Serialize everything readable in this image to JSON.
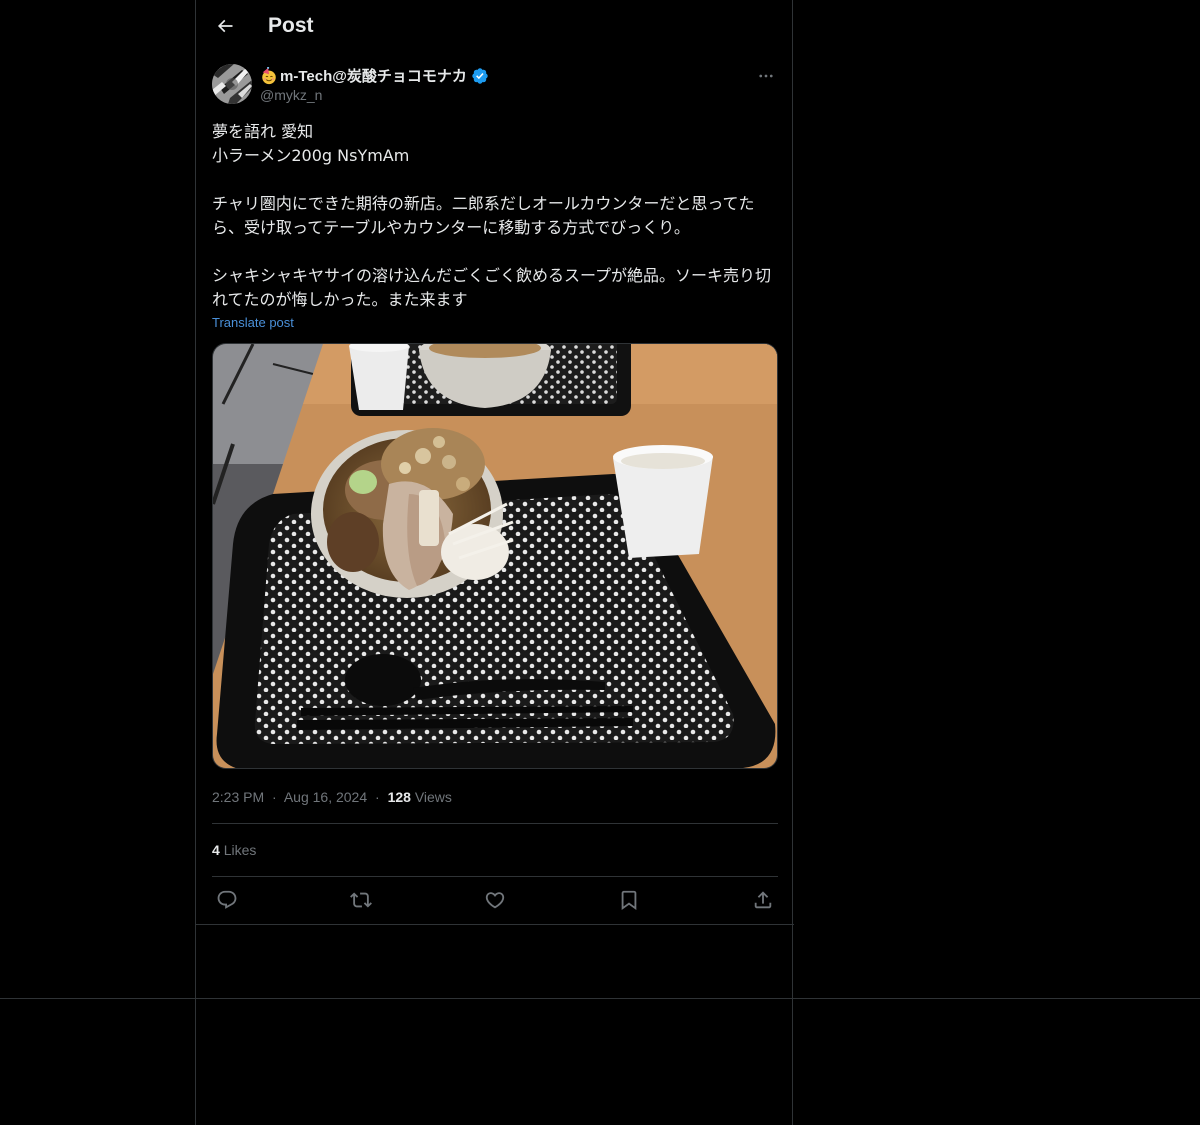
{
  "header": {
    "title": "Post"
  },
  "post": {
    "author": {
      "display_name": "m-Tech@炭酸チョコモナカ",
      "handle": "@mykz_n",
      "verified": true
    },
    "text": "夢を語れ 愛知\n小ラーメン200g NsYmAm\n\nチャリ圏内にできた期待の新店。二郎系だしオールカウンターだと思ってたら、受け取ってテーブルやカウンターに移動する方式でびっくり。\n\nシャキシャキヤサイの溶け込んだごくごく飲めるスープが絶品。ソーキ売り切れてたのが悔しかった。また来ます",
    "translate_label": "Translate post",
    "time": "2:23 PM",
    "date": "Aug 16, 2024",
    "separator": "·",
    "views_count": "128",
    "views_label": "Views",
    "likes_count": "4",
    "likes_label": "Likes"
  },
  "icons": {
    "back": "arrow-left-icon",
    "more": "more-horizontal-icon",
    "reply": "reply-icon",
    "repost": "repost-icon",
    "like": "heart-icon",
    "bookmark": "bookmark-icon",
    "share": "share-icon",
    "verified": "verified-badge-icon",
    "emoji": "smiling-face-with-party-hat-icon"
  },
  "colors": {
    "background": "#000000",
    "text": "#e7e9ea",
    "muted": "#71767b",
    "border": "#2f3336",
    "accent": "#1d9bf0"
  }
}
